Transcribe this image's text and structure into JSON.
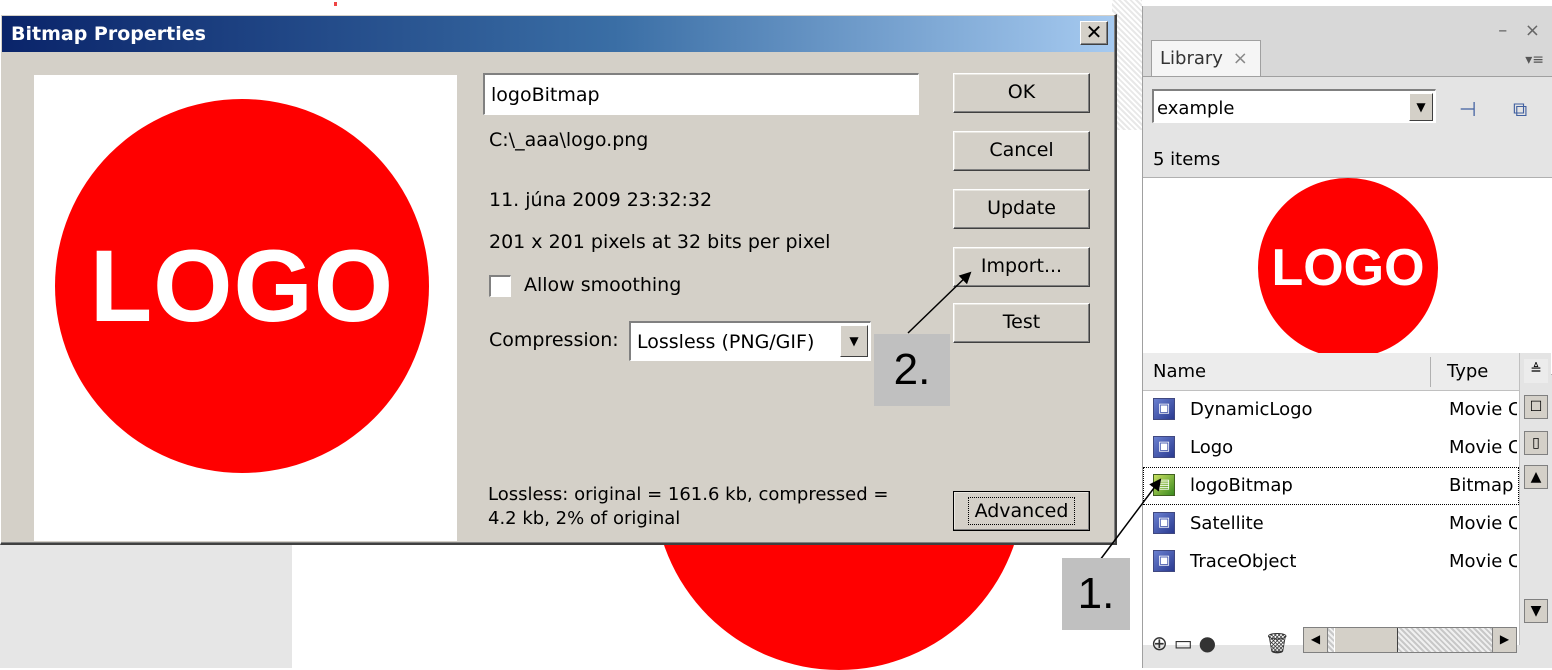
{
  "dialog": {
    "title": "Bitmap Properties",
    "close_glyph": "✕",
    "preview_logo_text": "LOGO",
    "name_value": "logoBitmap",
    "path": "C:\\_aaa\\logo.png",
    "date": "11. júna 2009  23:32:32",
    "dimensions": "201 x 201 pixels at 32 bits per pixel",
    "allow_smoothing_label": "Allow smoothing",
    "allow_smoothing_checked": false,
    "compression_label": "Compression:",
    "compression_value": "Lossless (PNG/GIF)",
    "info_line1": "Lossless: original = 161.6 kb, compressed =",
    "info_line2": "4.2 kb, 2% of original",
    "buttons": {
      "ok": "OK",
      "cancel": "Cancel",
      "update": "Update",
      "import": "Import...",
      "test": "Test",
      "advanced": "Advanced"
    }
  },
  "callouts": {
    "one": "1.",
    "two": "2."
  },
  "library": {
    "tab_label": "Library",
    "tab_close": "×",
    "panel_controls": "– ×",
    "menu_glyph": "▾≡",
    "document_value": "example",
    "item_count": "5 items",
    "preview_logo_text": "LOGO",
    "columns": {
      "name": "Name",
      "type": "Type"
    },
    "items": [
      {
        "name": "DynamicLogo",
        "type": "Movie Clip",
        "icon": "movieclip-icon"
      },
      {
        "name": "Logo",
        "type": "Movie Clip",
        "icon": "movieclip-icon"
      },
      {
        "name": "logoBitmap",
        "type": "Bitmap",
        "icon": "bitmap-icon"
      },
      {
        "name": "Satellite",
        "type": "Movie Clip",
        "icon": "movieclip-icon"
      },
      {
        "name": "TraceObject",
        "type": "Movie Clip",
        "icon": "movieclip-icon"
      }
    ]
  },
  "colors": {
    "logo_red": "#ff0000",
    "dialog_face": "#d4d0c8",
    "titlebar_start": "#0a246a",
    "titlebar_end": "#a6caf0"
  }
}
